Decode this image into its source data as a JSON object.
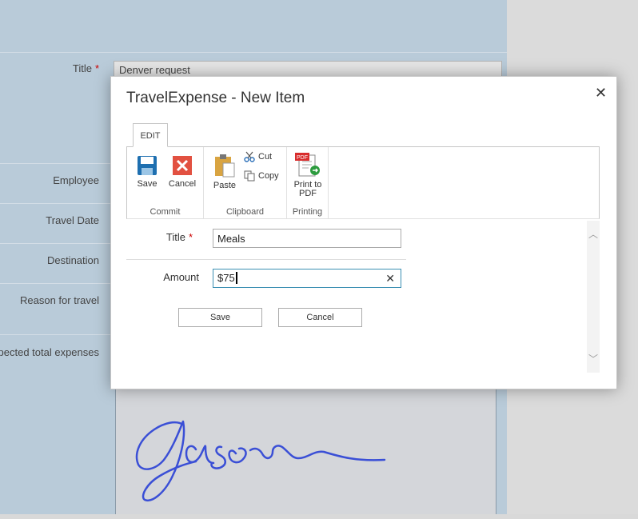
{
  "background_form": {
    "title_label": "Title",
    "title_value": "Denver request",
    "labels": [
      "Employee",
      "Travel Date",
      "Destination",
      "Reason for travel",
      "pected total expenses"
    ]
  },
  "dialog": {
    "title": "TravelExpense - New Item",
    "tab_edit": "EDIT",
    "ribbon": {
      "commit": {
        "label": "Commit",
        "save": "Save",
        "cancel": "Cancel"
      },
      "clipboard": {
        "label": "Clipboard",
        "paste": "Paste",
        "cut": "Cut",
        "copy": "Copy"
      },
      "printing": {
        "label": "Printing",
        "print_line1": "Print to",
        "print_line2": "PDF",
        "pdf_badge": "PDF"
      }
    },
    "fields": {
      "title_label": "Title",
      "title_value": "Meals",
      "amount_label": "Amount",
      "amount_value": "$75"
    },
    "buttons": {
      "save": "Save",
      "cancel": "Cancel"
    }
  },
  "colors": {
    "accent": "#3c8fb3",
    "required": "#cc0000",
    "signature": "#3a4fd6"
  }
}
